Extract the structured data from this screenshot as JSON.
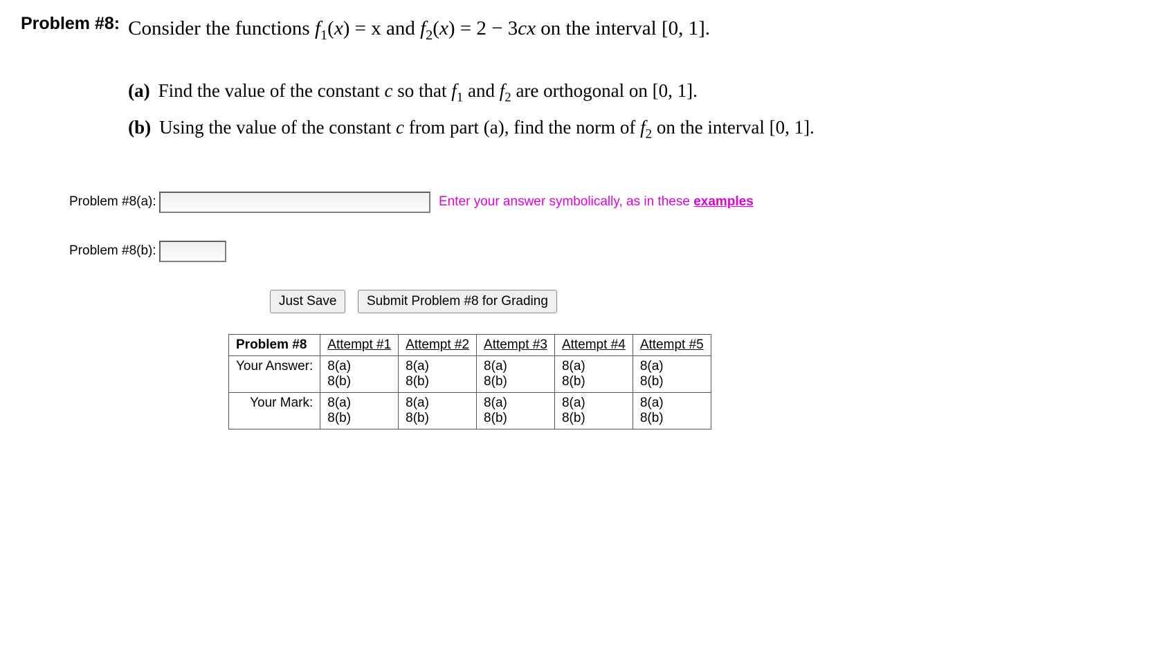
{
  "problem": {
    "label": "Problem #8:",
    "intro_pre": "Consider the functions  ",
    "intro_f1": "f",
    "intro_f1_sub": "1",
    "intro_f1_arg": "(x)",
    "intro_eq1": "  =  x  and  ",
    "intro_f2": "f",
    "intro_f2_sub": "2",
    "intro_f2_arg": "(x)",
    "intro_eq2": "  =  2 − 3",
    "intro_cx": "cx",
    "intro_post": "  on the interval [0, 1].",
    "parts": {
      "a": {
        "label": "(a)",
        "pre": "Find the value of the constant ",
        "c": "c",
        "mid": " so that  ",
        "f1": "f",
        "f1_sub": "1",
        "and": "  and  ",
        "f2": "f",
        "f2_sub": "2",
        "post": " are orthogonal on [0, 1]."
      },
      "b": {
        "label": "(b)",
        "pre": "Using the value of the constant ",
        "c": "c",
        "mid": " from part (a), find the norm of  ",
        "f2": "f",
        "f2_sub": "2",
        "post": "  on the interval [0, 1]."
      }
    }
  },
  "answers": {
    "a": {
      "label": "Problem #8(a):"
    },
    "b": {
      "label": "Problem #8(b):"
    }
  },
  "hint": {
    "text_pre": "Enter your answer symbolically, as in these ",
    "link": "examples"
  },
  "buttons": {
    "save": "Just Save",
    "submit": "Submit Problem #8 for Grading"
  },
  "table": {
    "problem_header": "Problem #8",
    "attempts": [
      "Attempt #1",
      "Attempt #2",
      "Attempt #3",
      "Attempt #4",
      "Attempt #5"
    ],
    "rows": [
      {
        "header": "Your Answer:",
        "cells": [
          "8(a)\n8(b)",
          "8(a)\n8(b)",
          "8(a)\n8(b)",
          "8(a)\n8(b)",
          "8(a)\n8(b)"
        ]
      },
      {
        "header": "Your Mark:",
        "cells": [
          "8(a)\n8(b)",
          "8(a)\n8(b)",
          "8(a)\n8(b)",
          "8(a)\n8(b)",
          "8(a)\n8(b)"
        ]
      }
    ]
  }
}
